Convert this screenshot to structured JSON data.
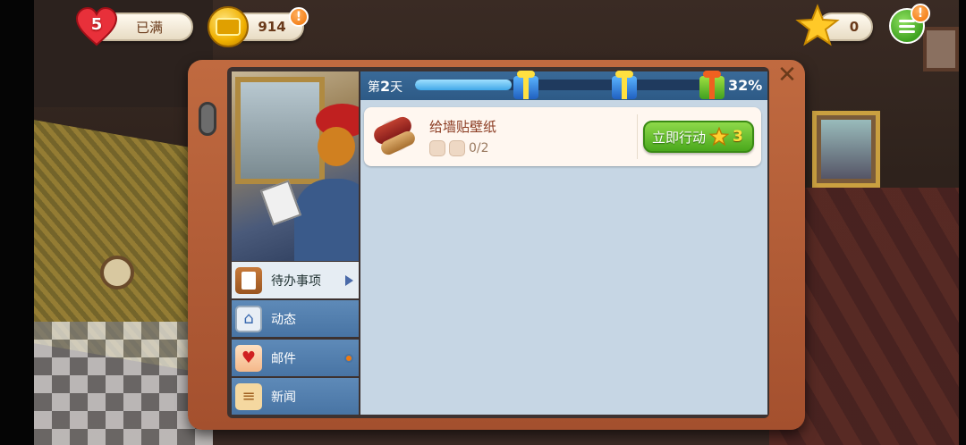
{
  "hud": {
    "lives": {
      "count": "5",
      "status": "已满",
      "icon": "heart-icon"
    },
    "coins": {
      "value": "914",
      "badge": "!",
      "icon": "coin-icon"
    },
    "stars": {
      "value": "0",
      "icon": "star-icon"
    },
    "menu": {
      "badge": "!",
      "icon": "list-menu-icon"
    }
  },
  "dialog": {
    "close_icon": "close-icon",
    "header": {
      "day_prefix": "第",
      "day_number": "2",
      "day_suffix": "天",
      "progress": 0.32,
      "percent_label": "32%",
      "milestones": [
        "gift-blue",
        "gift-blue",
        "gift-green"
      ]
    },
    "side_menu": [
      {
        "label": "待办事项",
        "icon": "clipboard-icon",
        "active": true
      },
      {
        "label": "动态",
        "icon": "news-feed-icon",
        "active": false
      },
      {
        "label": "邮件",
        "icon": "mail-icon",
        "active": false,
        "notification": true
      },
      {
        "label": "新闻",
        "icon": "newspaper-icon",
        "active": false
      }
    ],
    "tasks": [
      {
        "title": "给墙贴壁纸",
        "icon": "wallpaper-roll-icon",
        "progress": "0/2",
        "action_label": "立即行动",
        "reward": "3"
      }
    ]
  },
  "colors": {
    "accent_green": "#4aa81c",
    "header_blue": "#2d5a86",
    "dialog_frame": "#a4502e",
    "notification_orange": "#f07000"
  }
}
